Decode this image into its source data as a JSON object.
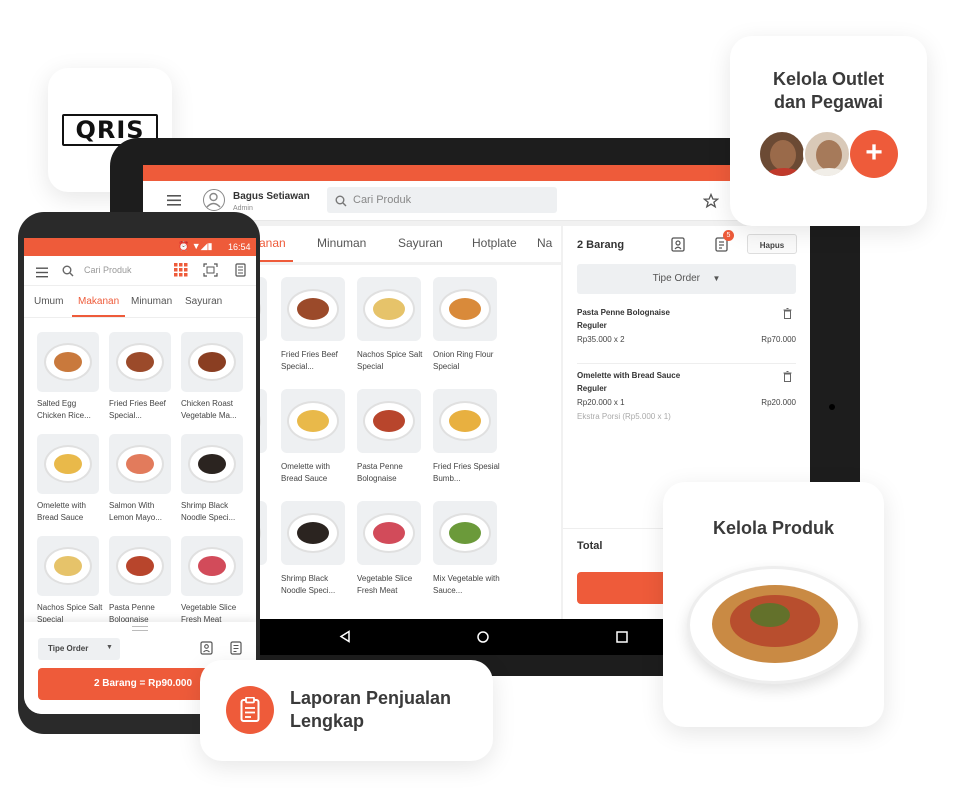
{
  "qris": {
    "logo_text": "QRIS"
  },
  "tablet": {
    "user_name": "Bagus Setiawan",
    "user_role": "Admin",
    "search_placeholder": "Cari Produk",
    "tabs": [
      "anan",
      "Minuman",
      "Sayuran",
      "Hotplate",
      "Na"
    ],
    "products": [
      {
        "name": "Salted Egg Chicken Rice...",
        "color": "#c9793c"
      },
      {
        "name": "Fried Fries Beef Special...",
        "color": "#9b4a2a"
      },
      {
        "name": "Nachos Spice Salt Special",
        "color": "#e6c36a"
      },
      {
        "name": "Onion Ring Flour Special",
        "color": "#d98a3a"
      },
      {
        "name": "Chicken Roast Vegetable Ma...",
        "color": "#8a3e22"
      },
      {
        "name": "Omelette with Bread Sauce",
        "color": "#e9b94a"
      },
      {
        "name": "Pasta Penne Bolognaise",
        "color": "#b8452c"
      },
      {
        "name": "Fried Fries Spesial Bumb...",
        "color": "#e8b040"
      },
      {
        "name": "Salmon With Lemon Mayo...",
        "color": "#e27b5c"
      },
      {
        "name": "Shrimp Black Noodle Speci...",
        "color": "#2b2420"
      },
      {
        "name": "Vegetable Slice Fresh Meat",
        "color": "#d24b5a"
      },
      {
        "name": "Mix Vegetable with Sauce...",
        "color": "#6b9a3a"
      }
    ],
    "order": {
      "count_label": "2 Barang",
      "badge": "5",
      "clear_label": "Hapus",
      "order_type": "Tipe Order",
      "items": [
        {
          "name": "Pasta Penne Bolognaise",
          "variant": "Reguler",
          "price_qty": "Rp35.000 x 2",
          "total": "Rp70.000",
          "extra": ""
        },
        {
          "name": "Omelette with Bread Sauce",
          "variant": "Reguler",
          "price_qty": "Rp20.000 x 1",
          "total": "Rp20.000",
          "extra": "Ekstra Porsi (Rp5.000 x 1)"
        }
      ],
      "total_label": "Total"
    }
  },
  "phone": {
    "time": "16:54",
    "search_placeholder": "Cari Produk",
    "tabs": [
      "Umum",
      "Makanan",
      "Minuman",
      "Sayuran"
    ],
    "products": [
      {
        "name": "Salted Egg Chicken Rice...",
        "color": "#c9793c"
      },
      {
        "name": "Fried Fries Beef Special...",
        "color": "#9b4a2a"
      },
      {
        "name": "Chicken Roast Vegetable Ma...",
        "color": "#8a3e22"
      },
      {
        "name": "Omelette with Bread Sauce",
        "color": "#e9b94a"
      },
      {
        "name": "Salmon With Lemon Mayo...",
        "color": "#e27b5c"
      },
      {
        "name": "Shrimp Black Noodle Speci...",
        "color": "#2b2420"
      },
      {
        "name": "Nachos Spice Salt Special",
        "color": "#e6c36a"
      },
      {
        "name": "Pasta Penne Bolognaise",
        "color": "#b8452c"
      },
      {
        "name": "Vegetable Slice Fresh Meat",
        "color": "#d24b5a"
      }
    ],
    "order_type": "Tipe Order",
    "checkout": "2 Barang = Rp90.000"
  },
  "cards": {
    "outlet_title_1": "Kelola Outlet",
    "outlet_title_2": "dan Pegawai",
    "produk_title": "Kelola Produk",
    "laporan_title_1": "Laporan Penjualan",
    "laporan_title_2": "Lengkap"
  },
  "colors": {
    "accent": "#ee5b3a"
  }
}
